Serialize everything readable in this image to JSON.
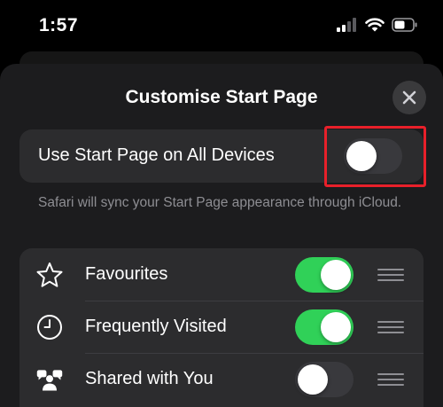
{
  "status_bar": {
    "time": "1:57",
    "icons": [
      "cellular-signal-icon",
      "wifi-icon",
      "battery-icon"
    ]
  },
  "sheet": {
    "title": "Customise Start Page",
    "close_icon": "close-icon"
  },
  "sync": {
    "label": "Use Start Page on All Devices",
    "enabled": false,
    "footnote": "Safari will sync your Start Page appearance through iCloud."
  },
  "sections": [
    {
      "label": "Favourites",
      "icon": "star-icon",
      "enabled": true
    },
    {
      "label": "Frequently Visited",
      "icon": "clock-icon",
      "enabled": true
    },
    {
      "label": "Shared with You",
      "icon": "shared-with-you-icon",
      "enabled": false
    }
  ],
  "colors": {
    "toggle_on": "#30d158",
    "toggle_off": "#39393d",
    "highlight": "#e8202a",
    "sheet_bg": "#1c1c1e",
    "card_bg": "#2c2c2e"
  }
}
